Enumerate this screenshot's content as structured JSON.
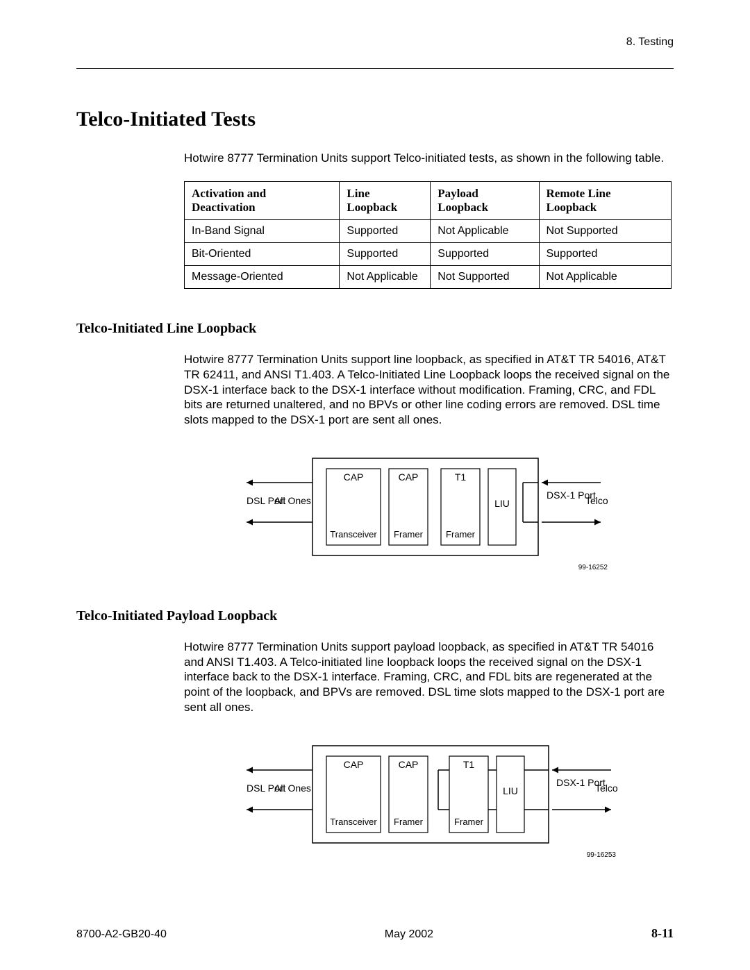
{
  "header": {
    "chapter": "8. Testing"
  },
  "title": "Telco-Initiated Tests",
  "intro": "Hotwire 8777 Termination Units support Telco-initiated tests, as shown in the following table.",
  "table": {
    "headers": {
      "c0": "Activation and Deactivation",
      "c1": "Line Loopback",
      "c2": "Payload Loopback",
      "c3": "Remote Line Loopback"
    },
    "rows": [
      {
        "c0": "In-Band Signal",
        "c1": "Supported",
        "c2": "Not Applicable",
        "c3": "Not Supported"
      },
      {
        "c0": "Bit-Oriented",
        "c1": "Supported",
        "c2": "Supported",
        "c3": "Supported"
      },
      {
        "c0": "Message-Oriented",
        "c1": "Not Applicable",
        "c2": "Not Supported",
        "c3": "Not Applicable"
      }
    ]
  },
  "section1": {
    "heading": "Telco-Initiated Line Loopback",
    "body": "Hotwire 8777 Termination Units support line loopback, as specified in AT&T TR 54016, AT&T TR 62411, and ANSI T1.403. A Telco-Initiated Line Loopback loops the received signal on the DSX-1 interface back to the DSX-1 interface without modification. Framing, CRC, and FDL bits are returned unaltered, and no BPVs or other line coding errors are removed. DSL time slots mapped to the DSX-1 port are sent all ones."
  },
  "section2": {
    "heading": "Telco-Initiated Payload Loopback",
    "body": "Hotwire 8777 Termination Units support payload loopback, as specified in AT&T TR 54016 and ANSI T1.403. A Telco-initiated line loopback loops the received signal on the DSX-1 interface back to the DSX-1 interface. Framing, CRC, and FDL bits are regenerated at the point of the loopback, and BPVs are removed. DSL time slots mapped to the DSX-1 port are sent all ones."
  },
  "diagram": {
    "dsl_port": "DSL Port",
    "all_ones": "All Ones",
    "cap": "CAP",
    "transceiver": "Transceiver",
    "framer": "Framer",
    "t1": "T1",
    "liu": "LIU",
    "dsx1_port": "DSX-1 Port",
    "telco": "Telco",
    "fig1_id": "99-16252",
    "fig2_id": "99-16253"
  },
  "footer": {
    "doc": "8700-A2-GB20-40",
    "date": "May 2002",
    "page": "8-11"
  }
}
